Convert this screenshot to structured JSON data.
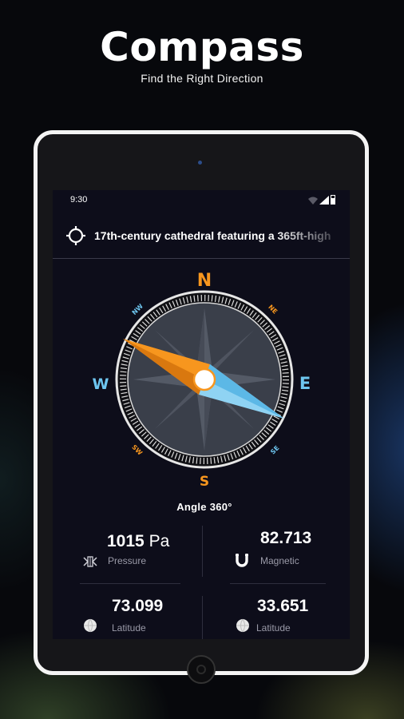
{
  "promo": {
    "title": "Compass",
    "subtitle": "Find the Right Direction"
  },
  "status_bar": {
    "time": "9:30"
  },
  "location": {
    "text": "17th-century cathedral featuring a 365ft-high"
  },
  "compass": {
    "cardinals": {
      "n": "N",
      "s": "S",
      "e": "E",
      "w": "W"
    },
    "intercardinals": {
      "nw": "NW",
      "ne": "NE",
      "sw": "SW",
      "se": "SE"
    },
    "angle_label": "Angle 360°",
    "colors": {
      "accent": "#f7961e",
      "blue": "#6ec6f0",
      "face": "#3a3f4a"
    }
  },
  "stats": {
    "pressure": {
      "value": "1015",
      "unit": "Pa",
      "label": "Pressure",
      "icon": "pressure-icon"
    },
    "magnetic": {
      "value": "82.713",
      "label": "Magnetic",
      "icon": "magnet-icon"
    },
    "latitude_1": {
      "value": "73.099",
      "label": "Latitude",
      "icon": "globe-icon"
    },
    "latitude_2": {
      "value": "33.651",
      "label": "Latitude",
      "icon": "globe-icon"
    }
  }
}
